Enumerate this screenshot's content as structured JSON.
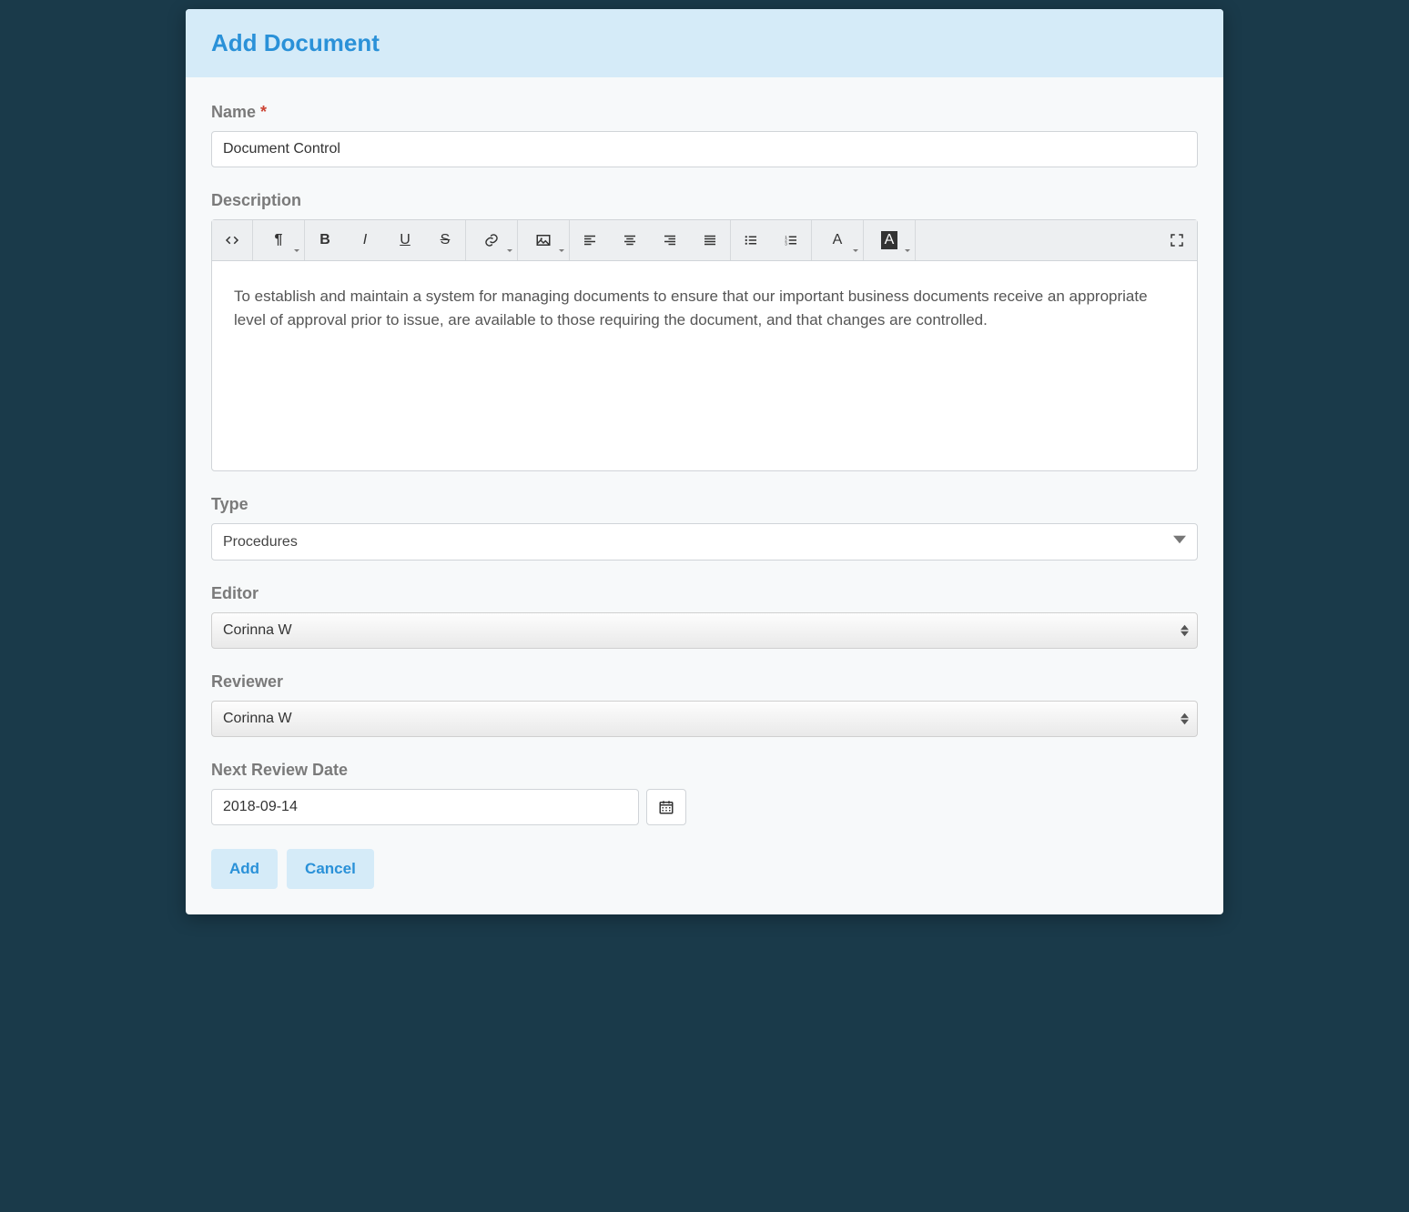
{
  "modal": {
    "title": "Add Document"
  },
  "form": {
    "name": {
      "label": "Name",
      "required_marker": "*",
      "value": "Document Control"
    },
    "description": {
      "label": "Description",
      "value": "To establish and maintain a system for managing documents to ensure that our important business documents receive an appropriate level of approval prior to issue, are available to those requiring the document, and that changes are controlled."
    },
    "type": {
      "label": "Type",
      "value": "Procedures"
    },
    "editor_person": {
      "label": "Editor",
      "value": "Corinna W"
    },
    "reviewer": {
      "label": "Reviewer",
      "value": "Corinna W"
    },
    "next_review": {
      "label": "Next Review Date",
      "value": "2018-09-14"
    }
  },
  "toolbar": {
    "code": "code-view-icon",
    "paragraph": "paragraph-format-icon",
    "bold": "B",
    "italic": "I",
    "underline": "U",
    "strike": "S",
    "text_color": "A",
    "bg_color": "A"
  },
  "actions": {
    "add": "Add",
    "cancel": "Cancel"
  }
}
